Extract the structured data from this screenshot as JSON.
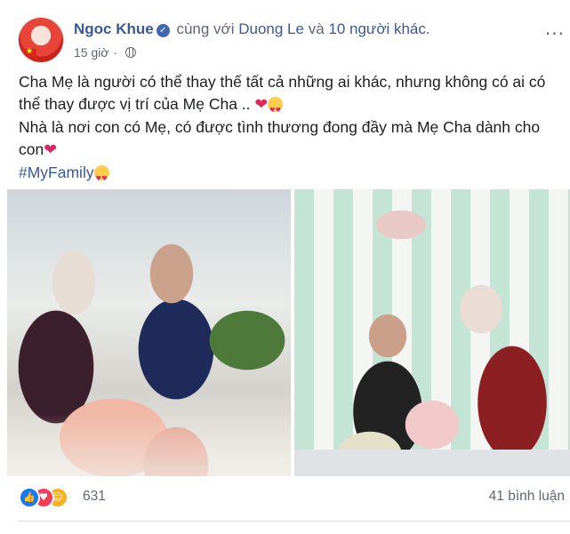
{
  "post": {
    "author": "Ngoc Khue",
    "with_prefix": "cùng với",
    "tagged_person": "Duong Le",
    "and_text": "và",
    "others": "10 người khác.",
    "time": "15 giờ",
    "privacy_icon": "globe-icon",
    "verified_icon": "verified-badge-icon",
    "more_label": "···",
    "paragraph1": "Cha Mẹ là người có thể thay thế tất cả những ai khác, nhưng không có ai có thể thay được vị trí của Mẹ Cha .. ",
    "paragraph2": "Nhà là nơi con có Mẹ, có được tình thương đong đầy mà Mẹ Cha dành cho con",
    "hashtag": "#MyFamily",
    "heart_emoji": "❤",
    "photo_left_icon": "family-photo-left",
    "photo_right_icon": "family-photo-right"
  },
  "footer": {
    "reaction_icons": [
      "like-icon",
      "love-icon",
      "care-icon"
    ],
    "reaction_count": "631",
    "comments": "41 bình luận"
  },
  "colors": {
    "link": "#385898",
    "muted": "#606770",
    "like": "#1877f2",
    "love": "#f33e58",
    "care": "#f7b125"
  }
}
